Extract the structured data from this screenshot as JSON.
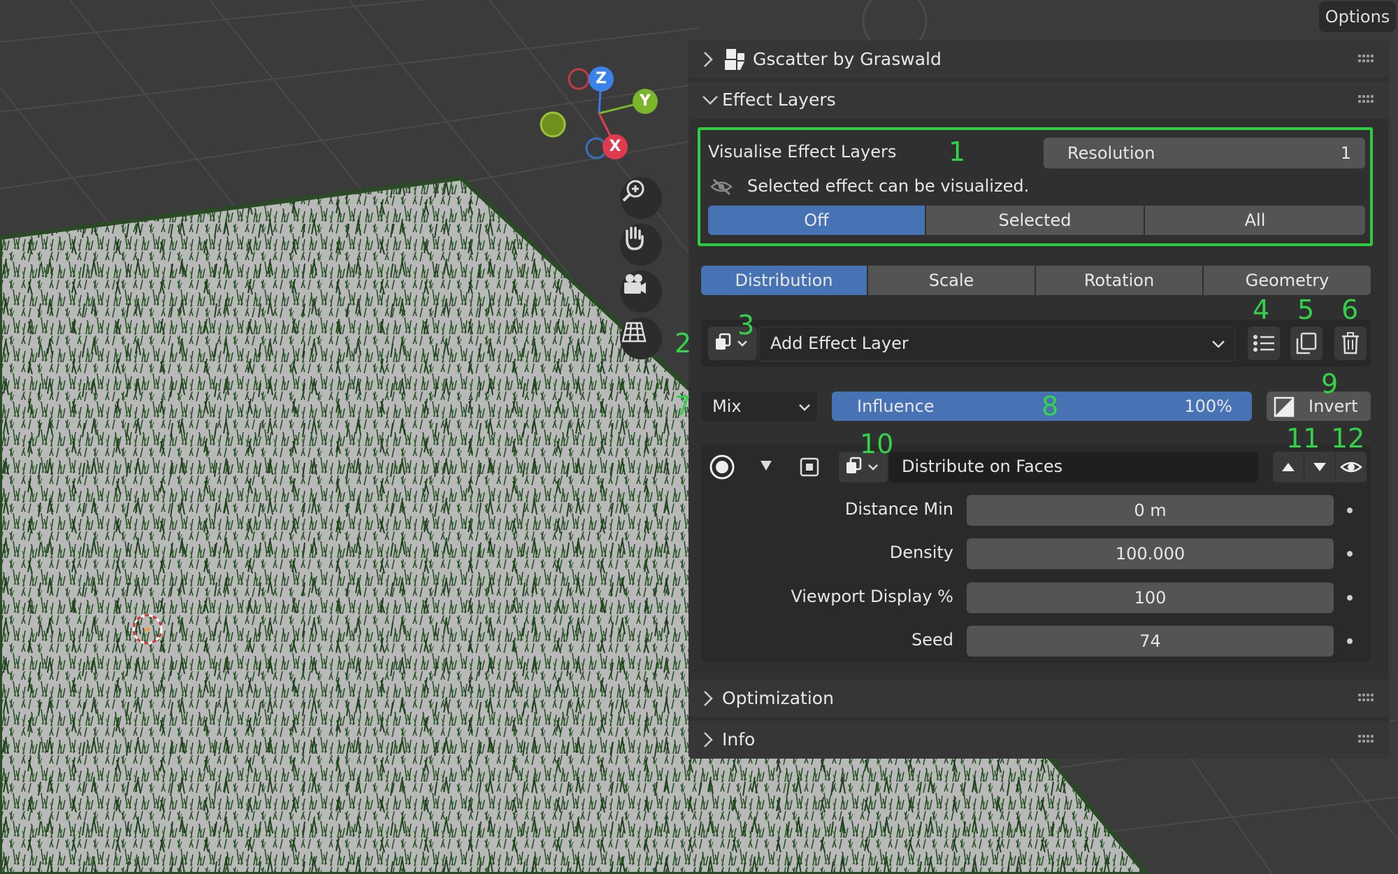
{
  "top_right": {
    "options_label": "Options"
  },
  "gizmo": {
    "z": "Z",
    "y": "Y",
    "x": "X"
  },
  "panels": {
    "gscatter": {
      "title": "Gscatter by Graswald"
    },
    "effect_layers": {
      "title": "Effect Layers"
    },
    "optimization": {
      "title": "Optimization"
    },
    "info": {
      "title": "Info"
    }
  },
  "visualise": {
    "label": "Visualise Effect Layers",
    "resolution_label": "Resolution",
    "resolution_value": "1",
    "message": "Selected effect can be visualized.",
    "modes": [
      "Off",
      "Selected",
      "All"
    ],
    "active_mode": "Off"
  },
  "tabs": [
    "Distribution",
    "Scale",
    "Rotation",
    "Geometry"
  ],
  "active_tab": "Distribution",
  "layer_row": {
    "add_label": "Add Effect Layer"
  },
  "blend": {
    "mode": "Mix",
    "influence_label": "Influence",
    "influence_value": "100%",
    "influence_fraction": 1.0,
    "invert_label": "Invert"
  },
  "effect": {
    "name": "Distribute on Faces",
    "props": [
      {
        "label": "Distance Min",
        "value": "0 m"
      },
      {
        "label": "Density",
        "value": "100.000"
      },
      {
        "label": "Viewport Display %",
        "value": "100"
      },
      {
        "label": "Seed",
        "value": "74"
      }
    ]
  },
  "annotations": [
    "1",
    "2",
    "3",
    "4",
    "5",
    "6",
    "7",
    "8",
    "9",
    "10",
    "11",
    "12"
  ],
  "colors": {
    "accent": "#4772b3",
    "highlight_box": "#2ecc40",
    "annotation": "#33d24a",
    "panel_bg": "#303030",
    "field_bg": "#545454"
  }
}
